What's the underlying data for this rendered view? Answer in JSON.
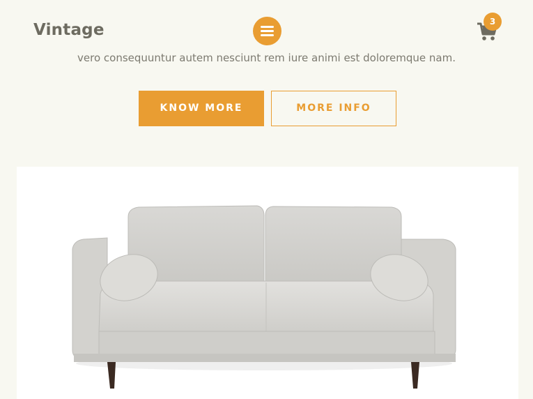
{
  "header": {
    "brand": "Vintage",
    "menu_icon": "hamburger-menu-icon",
    "cart_icon": "shopping-cart-icon",
    "cart_count": "3"
  },
  "hero": {
    "tagline": "vero consequuntur autem nesciunt rem iure animi est doloremque nam.",
    "primary_button": "KNOW MORE",
    "secondary_button": "MORE INFO"
  },
  "product_image": {
    "subject": "sofa-image"
  },
  "colors": {
    "accent": "#e99d32",
    "background": "#f8f8f1",
    "brand_text": "#6d6b60"
  }
}
